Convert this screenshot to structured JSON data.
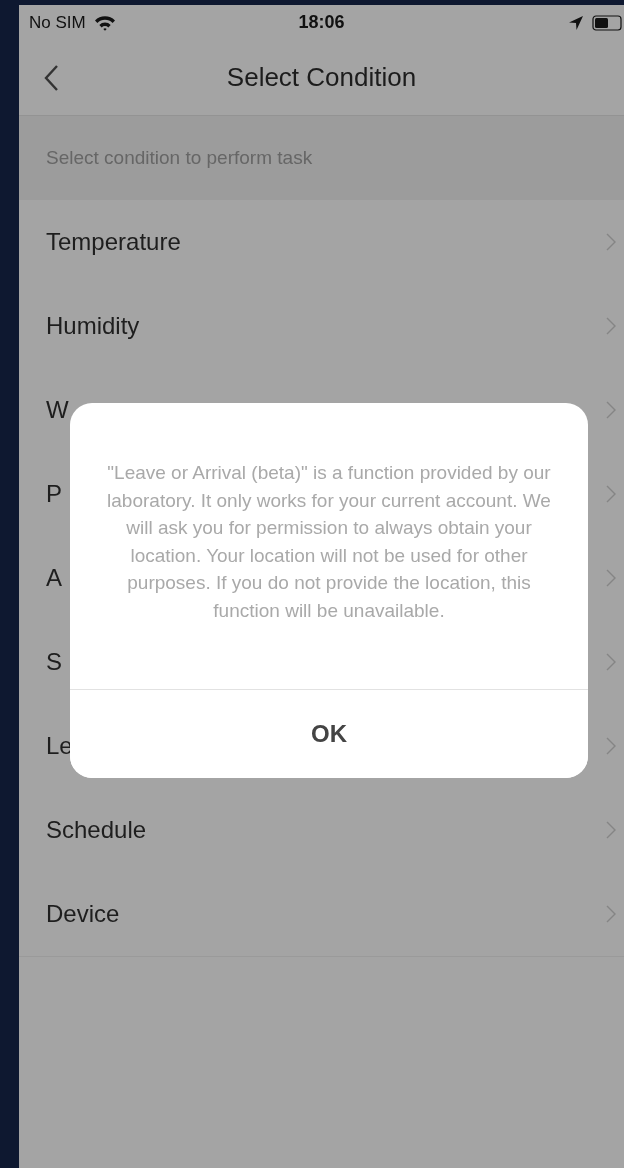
{
  "status_bar": {
    "carrier": "No SIM",
    "time": "18:06"
  },
  "nav": {
    "title": "Select Condition"
  },
  "section_header": "Select condition to perform task",
  "conditions": [
    {
      "label": "Temperature"
    },
    {
      "label": "Humidity"
    },
    {
      "label": "W"
    },
    {
      "label": "P"
    },
    {
      "label": "A"
    },
    {
      "label": "S"
    },
    {
      "label": "Le"
    },
    {
      "label": "Schedule"
    },
    {
      "label": "Device"
    }
  ],
  "dialog": {
    "message": "\"Leave or Arrival (beta)\" is a function provided by our laboratory. It only works for your current account. We will ask you for permission to always obtain your location. Your location will not be used for other purposes. If you do not provide the location, this function will be unavailable.",
    "button": "OK"
  }
}
